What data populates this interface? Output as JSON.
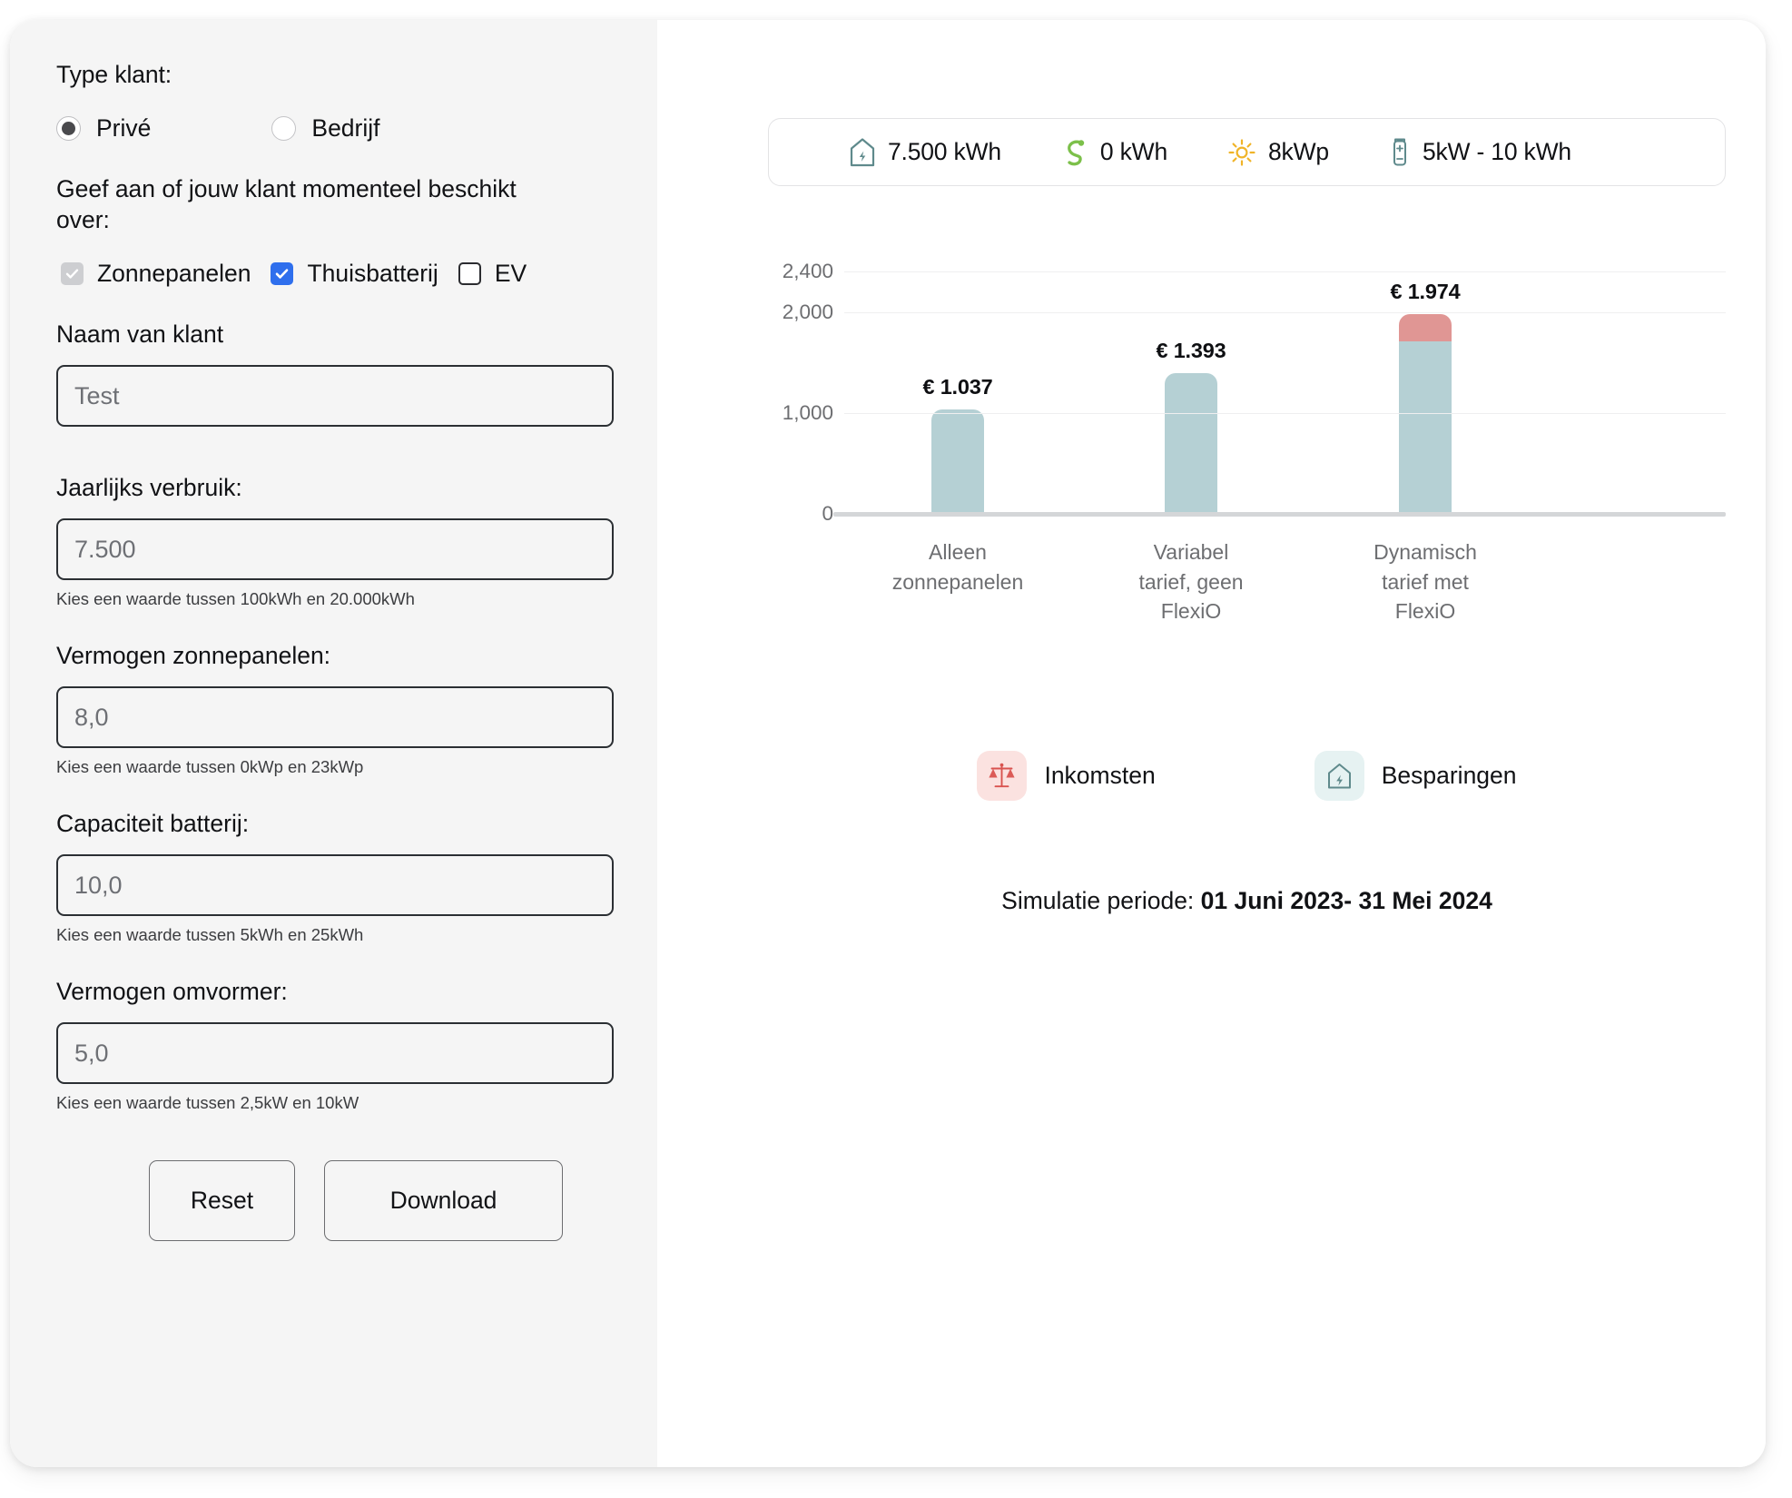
{
  "form": {
    "customer_type_label": "Type klant:",
    "radios": [
      {
        "label": "Privé",
        "selected": true
      },
      {
        "label": "Bedrijf",
        "selected": false
      }
    ],
    "assets_question": "Geef aan of jouw klant momenteel beschikt over:",
    "checkboxes": [
      {
        "label": "Zonnepanelen",
        "checked": true,
        "disabled": true
      },
      {
        "label": "Thuisbatterij",
        "checked": true,
        "disabled": false
      },
      {
        "label": "EV",
        "checked": false,
        "disabled": false
      }
    ],
    "fields": [
      {
        "label": "Naam van klant",
        "value": "Test",
        "placeholder": "Test",
        "hint": ""
      },
      {
        "label": "Jaarlijks verbruik:",
        "value": "7.500",
        "placeholder": "7.500",
        "hint": "Kies een waarde tussen 100kWh en 20.000kWh"
      },
      {
        "label": "Vermogen zonnepanelen:",
        "value": "8,0",
        "placeholder": "8,0",
        "hint": "Kies een waarde tussen 0kWp en 23kWp"
      },
      {
        "label": "Capaciteit batterij:",
        "value": "10,0",
        "placeholder": "10,0",
        "hint": "Kies een waarde tussen 5kWh en 25kWh"
      },
      {
        "label": "Vermogen omvormer:",
        "value": "5,0",
        "placeholder": "5,0",
        "hint": "Kies een waarde tussen 2,5kW en 10kW"
      }
    ],
    "buttons": {
      "reset": "Reset",
      "download": "Download"
    }
  },
  "summary": {
    "items": [
      {
        "icon": "house-bolt-icon",
        "text": "7.500 kWh",
        "color": "#5f8a8c"
      },
      {
        "icon": "ev-charger-cable-icon",
        "text": "0 kWh",
        "color": "#7cc04a"
      },
      {
        "icon": "sun-icon",
        "text": "8kWp",
        "color": "#f0b429"
      },
      {
        "icon": "battery-icon",
        "text": "5kW - 10 kWh",
        "color": "#5f8a8c"
      }
    ]
  },
  "chart_data": {
    "type": "bar",
    "title": "",
    "xlabel": "",
    "ylabel": "",
    "ylim": [
      0,
      2400
    ],
    "yticks": [
      0,
      1000,
      2000,
      2400
    ],
    "ytick_labels": [
      "0",
      "1,000",
      "2,000",
      "2,400"
    ],
    "grid": true,
    "stacked": true,
    "legend_position": "bottom",
    "categories": [
      "Alleen\nzonnepanelen",
      "Variabel\ntarief, geen\nFlexiO",
      "Dynamisch\ntarief met\nFlexiO"
    ],
    "series": [
      {
        "name": "Besparingen",
        "color": "#b5d0d4",
        "values": [
          1037,
          1393,
          1704
        ]
      },
      {
        "name": "Inkomsten",
        "color": "#e09694",
        "values": [
          0,
          0,
          270
        ]
      }
    ],
    "totals": [
      1037,
      1393,
      1974
    ],
    "data_labels": [
      "€ 1.037",
      "€ 1.393",
      "€ 1.974"
    ]
  },
  "legend": {
    "items": [
      {
        "label": "Inkomsten",
        "icon": "scales-icon",
        "chip_bg": "#fbe2e0",
        "icon_color": "#d9534f"
      },
      {
        "label": "Besparingen",
        "icon": "house-bolt-icon",
        "chip_bg": "#e6f2f2",
        "icon_color": "#5f8a8c"
      }
    ]
  },
  "footer": {
    "sim_label": "Simulatie periode: ",
    "sim_start": "01 Juni 2023- ",
    "sim_end": " 31 Mei 2024"
  }
}
